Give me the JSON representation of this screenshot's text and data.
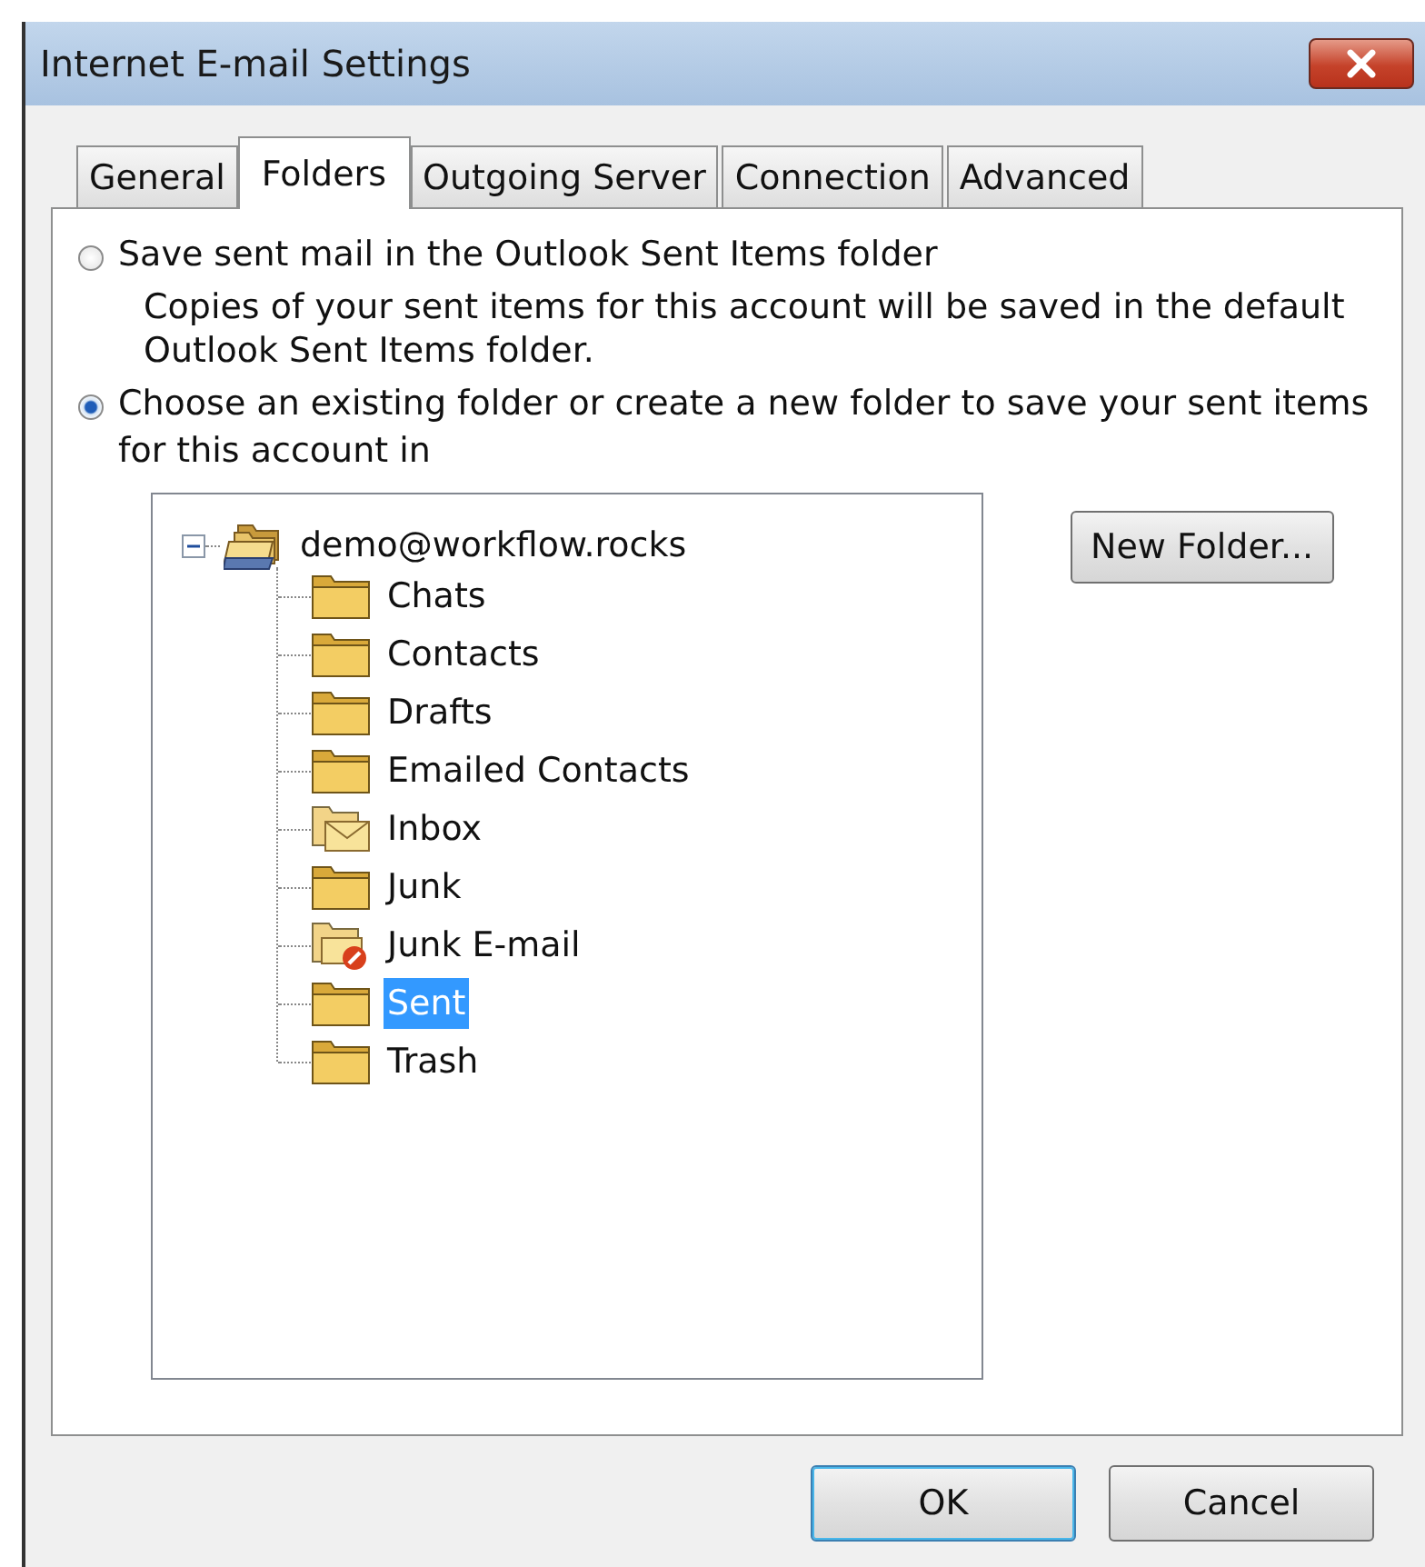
{
  "window": {
    "title": "Internet E-mail Settings"
  },
  "tabs": [
    {
      "label": "General",
      "selected": false
    },
    {
      "label": "Folders",
      "selected": true
    },
    {
      "label": "Outgoing Server",
      "selected": false
    },
    {
      "label": "Connection",
      "selected": false
    },
    {
      "label": "Advanced",
      "selected": false
    }
  ],
  "options": [
    {
      "label": "Save sent mail in the Outlook Sent Items folder",
      "description": "Copies of your sent items for this account will be saved in the default Outlook Sent Items folder.",
      "selected": false
    },
    {
      "label": "Choose an existing folder or create a new folder to save your sent items for this account in",
      "selected": true
    }
  ],
  "tree": {
    "label": "demo@workflow.rocks",
    "expanded": true,
    "children": [
      {
        "label": "Chats",
        "kind": "folder",
        "selected": false
      },
      {
        "label": "Contacts",
        "kind": "folder",
        "selected": false
      },
      {
        "label": "Drafts",
        "kind": "folder",
        "selected": false
      },
      {
        "label": "Emailed Contacts",
        "kind": "folder",
        "selected": false
      },
      {
        "label": "Inbox",
        "kind": "inbox",
        "selected": false
      },
      {
        "label": "Junk",
        "kind": "folder",
        "selected": false
      },
      {
        "label": "Junk E-mail",
        "kind": "junk",
        "selected": false
      },
      {
        "label": "Sent",
        "kind": "folder",
        "selected": true
      },
      {
        "label": "Trash",
        "kind": "folder",
        "selected": false
      }
    ]
  },
  "new_folder_button": "New Folder...",
  "buttons": [
    {
      "label": "OK",
      "default": true
    },
    {
      "label": "Cancel",
      "default": false
    }
  ]
}
